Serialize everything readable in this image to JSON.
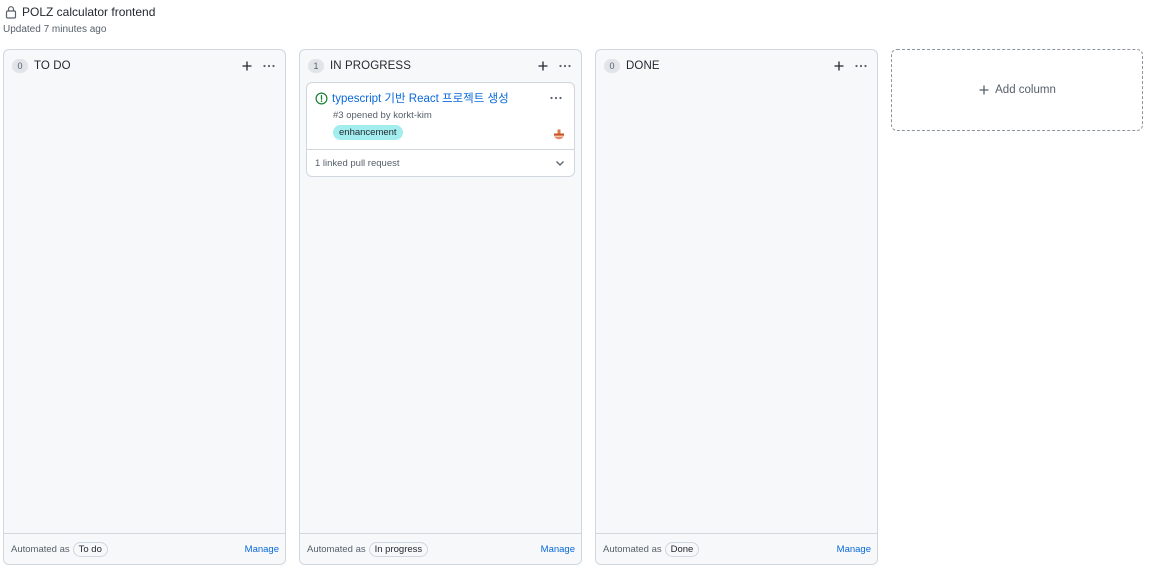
{
  "project": {
    "title": "POLZ calculator frontend",
    "updated": "Updated 7 minutes ago"
  },
  "columns": [
    {
      "count": "0",
      "title": "TO DO",
      "automated_label": "Automated as",
      "automated_value": "To do",
      "manage_label": "Manage"
    },
    {
      "count": "1",
      "title": "IN PROGRESS",
      "automated_label": "Automated as",
      "automated_value": "In progress",
      "manage_label": "Manage",
      "cards": [
        {
          "title": "typescript 기반 React 프로젝트 생성",
          "meta": "#3 opened by korkt-kim",
          "label": "enhancement",
          "footer": "1 linked pull request"
        }
      ]
    },
    {
      "count": "0",
      "title": "DONE",
      "automated_label": "Automated as",
      "automated_value": "Done",
      "manage_label": "Manage"
    }
  ],
  "add_column": {
    "label": "Add column"
  },
  "colors": {
    "link": "#0969da",
    "label_bg": "#a2eeef",
    "issue_open": "#1a7f37"
  }
}
